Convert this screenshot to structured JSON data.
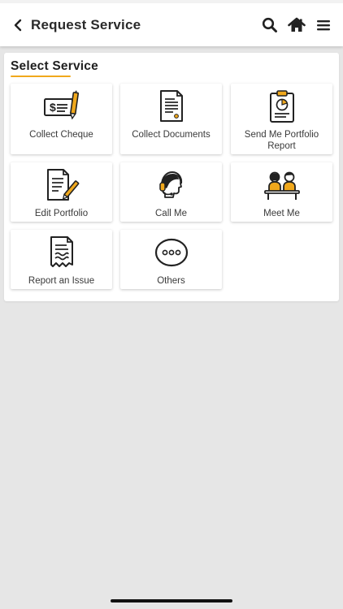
{
  "header": {
    "title": "Request Service",
    "back_icon": "chevron-left-icon",
    "actions": [
      "search-icon",
      "home-icon",
      "menu-icon"
    ]
  },
  "section": {
    "title": "Select Service",
    "accent_color": "#f0a81c"
  },
  "services": [
    {
      "label": "Collect Cheque",
      "icon": "cheque-pen-icon"
    },
    {
      "label": "Collect Documents",
      "icon": "document-icon"
    },
    {
      "label": "Send Me Portfolio Report",
      "icon": "clipboard-chart-icon"
    },
    {
      "label": "Edit Portfolio",
      "icon": "edit-document-icon"
    },
    {
      "label": "Call Me",
      "icon": "headset-agent-icon"
    },
    {
      "label": "Meet Me",
      "icon": "meeting-people-icon"
    },
    {
      "label": "Report an Issue",
      "icon": "torn-document-icon"
    },
    {
      "label": "Others",
      "icon": "more-dots-icon"
    }
  ]
}
